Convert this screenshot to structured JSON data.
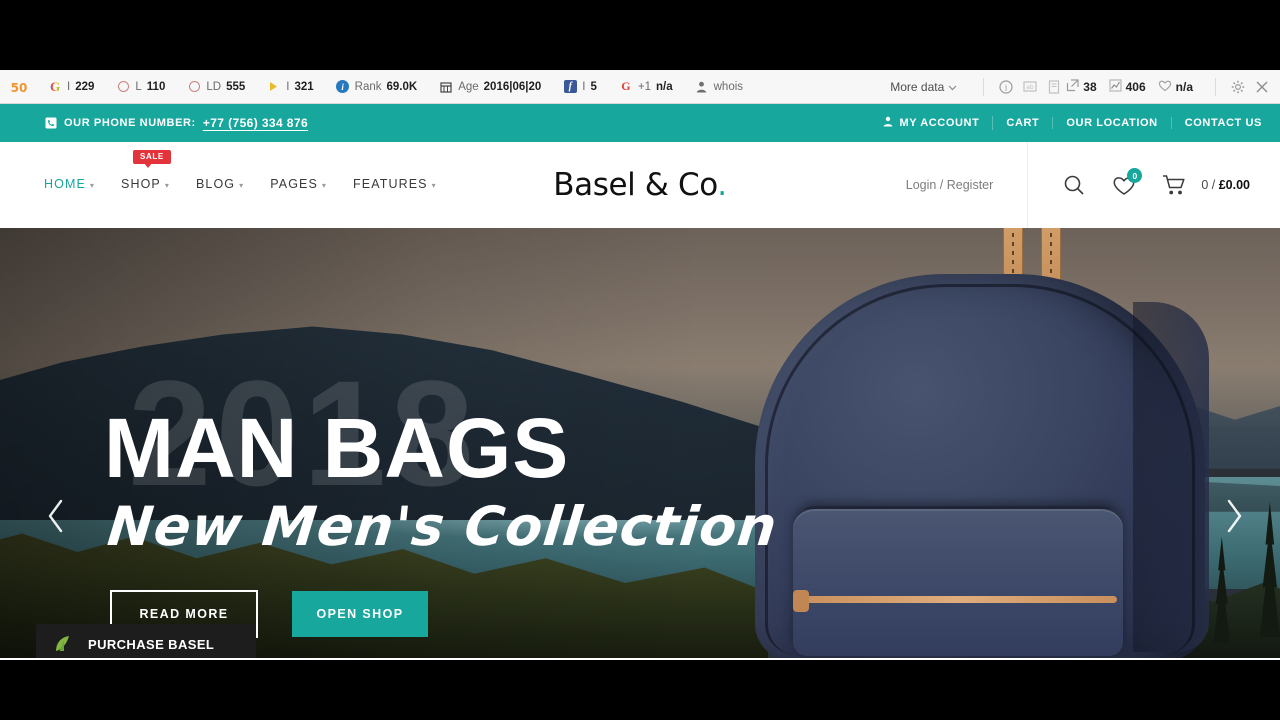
{
  "seo_toolbar": {
    "brand_icon": "seo-logo-icon",
    "items": [
      {
        "icon": "google-icon",
        "label": "I",
        "value": "229"
      },
      {
        "icon": "circle-icon",
        "label": "L",
        "value": "110"
      },
      {
        "icon": "circle-icon",
        "label": "LD",
        "value": "555"
      },
      {
        "icon": "yandex-icon",
        "label": "I",
        "value": "321"
      },
      {
        "icon": "info-circle-icon",
        "label": "Rank",
        "value": "69.0K"
      },
      {
        "icon": "calendar-icon",
        "label": "Age",
        "value": "2016|06|20"
      },
      {
        "icon": "facebook-icon",
        "label": "I",
        "value": "5"
      },
      {
        "icon": "google-plus-icon",
        "label": "+1",
        "value": "n/a"
      },
      {
        "icon": "person-icon",
        "label": "whois",
        "value": ""
      }
    ],
    "more_data_label": "More data",
    "right_icons": [
      {
        "icon": "info-icon",
        "value": ""
      },
      {
        "icon": "screenshot-icon",
        "value": ""
      },
      {
        "icon": "page-icon",
        "value": ""
      },
      {
        "icon": "external-link-icon",
        "value": "38"
      },
      {
        "icon": "chart-icon",
        "value": "406"
      },
      {
        "icon": "heart-outline-icon",
        "value": "n/a"
      }
    ],
    "settings_icon": "gear-icon",
    "close_icon": "close-icon"
  },
  "topbar": {
    "phone_icon": "phone-icon",
    "phone_label": "OUR PHONE NUMBER:",
    "phone_number": "+77 (756) 334 876",
    "links": [
      {
        "label": "MY ACCOUNT",
        "icon": "user-icon"
      },
      {
        "label": "CART",
        "icon": ""
      },
      {
        "label": "OUR LOCATION",
        "icon": ""
      },
      {
        "label": "CONTACT US",
        "icon": ""
      }
    ]
  },
  "header": {
    "nav": [
      {
        "label": "HOME",
        "caret": true,
        "active": true,
        "badge": ""
      },
      {
        "label": "SHOP",
        "caret": true,
        "active": false,
        "badge": "SALE"
      },
      {
        "label": "BLOG",
        "caret": true,
        "active": false,
        "badge": ""
      },
      {
        "label": "PAGES",
        "caret": true,
        "active": false,
        "badge": ""
      },
      {
        "label": "FEATURES",
        "caret": true,
        "active": false,
        "badge": ""
      }
    ],
    "logo_text": "Basel & Co",
    "logo_dot": ".",
    "login_label": "Login / Register",
    "search_icon": "search-icon",
    "wishlist_icon": "heart-icon",
    "wishlist_count": "0",
    "cart_icon": "cart-icon",
    "cart_count": "0",
    "cart_separator": "/",
    "cart_total": "£0.00"
  },
  "hero": {
    "ghost_year": "2018",
    "title": "MAN BAGS",
    "subtitle": "New Men's Collection",
    "btn_outline_label": "READ MORE",
    "btn_teal_label": "OPEN SHOP",
    "prev_icon": "chevron-left-icon",
    "next_icon": "chevron-right-icon"
  },
  "purchase_strip": {
    "logo_icon": "envato-leaf-icon",
    "prefix": "PURCHASE ",
    "brand": "BASEL"
  },
  "colors": {
    "teal": "#17a79d",
    "sale_red": "#e4343b",
    "toolbar_bg": "#f7f7f7",
    "dark_strip": "#1d1d1d"
  }
}
